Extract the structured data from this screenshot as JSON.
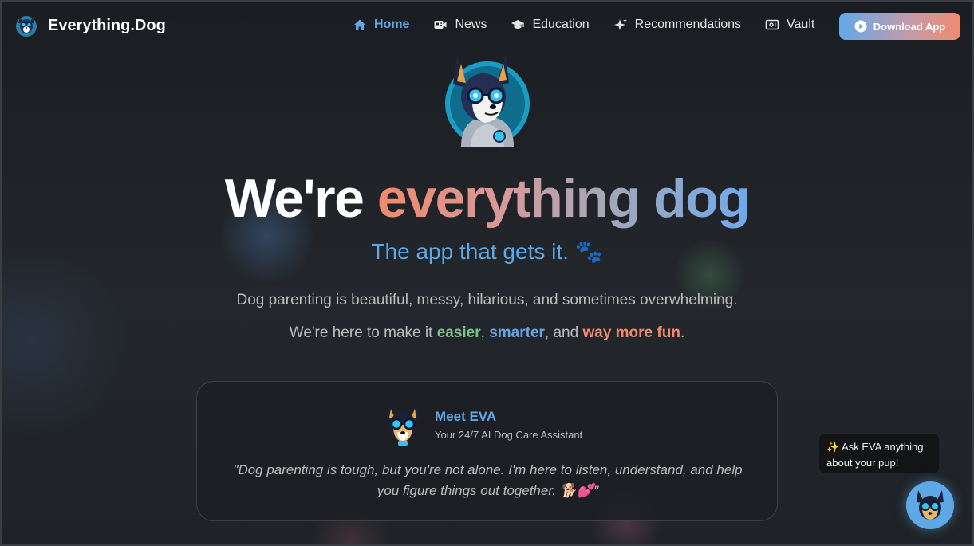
{
  "nav": {
    "brand_name": "Everything.Dog",
    "brand_logo_icon": "dog-logo-icon",
    "items": [
      {
        "label": "Home",
        "icon": "home-icon",
        "active": true
      },
      {
        "label": "News",
        "icon": "news-icon",
        "active": false
      },
      {
        "label": "Education",
        "icon": "graduation-cap-icon",
        "active": false
      },
      {
        "label": "Recommendations",
        "icon": "sparkles-icon",
        "active": false
      },
      {
        "label": "Vault",
        "icon": "vault-icon",
        "active": false
      }
    ],
    "download_button": {
      "label": "Download App",
      "icon": "play-circle-icon"
    }
  },
  "hero": {
    "avatar_icon": "robot-dog-avatar",
    "headline_plain": "We're ",
    "headline_gradient": "everything dog",
    "subtitle": "The app that gets it. 🐾",
    "description_line1": "Dog parenting is beautiful, messy, hilarious, and sometimes overwhelming.",
    "description_line2": {
      "prefix": "We're here to make it ",
      "word1": "easier",
      "sep1": ", ",
      "word2": "smarter",
      "sep2": ", and ",
      "word3": "way more fun",
      "suffix": "."
    }
  },
  "eva_card": {
    "title": "Meet EVA",
    "subtitle": "Your 24/7 AI Dog Care Assistant",
    "quote": "\"Dog parenting is tough, but you're not alone. I'm here to listen, understand, and help you figure things out together. 🐕💕\""
  },
  "floating": {
    "tooltip": "✨ Ask EVA anything about your pup!",
    "button_icon": "eva-dog-icon"
  },
  "colors": {
    "background": "#1d2126",
    "accent_blue": "#5fa8e8",
    "accent_green": "#7cc48a",
    "accent_coral": "#f08a6c"
  }
}
